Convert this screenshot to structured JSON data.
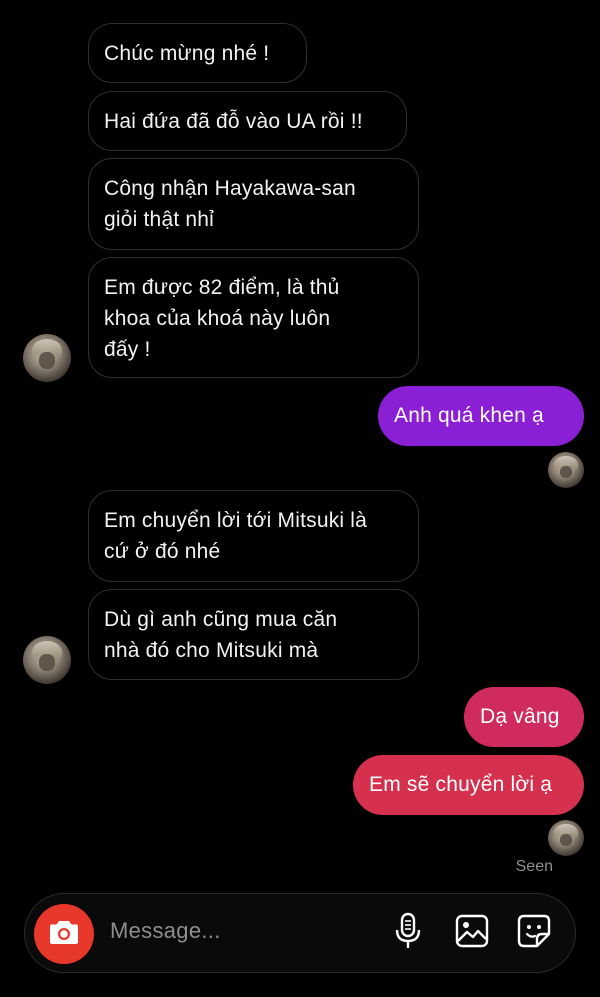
{
  "messages": [
    {
      "side": "in",
      "text": "Chúc mừng nhé !"
    },
    {
      "side": "in",
      "text": "Hai đứa đã đỗ vào UA rồi !!"
    },
    {
      "side": "in",
      "text": "Công nhận Hayakawa-san\ngiỏi thật nhỉ"
    },
    {
      "side": "in",
      "text": "Em được 82 điểm, là thủ\nkhoa của khoá này luôn\nđấy !"
    },
    {
      "side": "out",
      "text": "Anh quá khen ạ",
      "color": "#8a1fd6"
    },
    {
      "side": "in",
      "text": "Em chuyển lời tới Mitsuki là\ncứ ở đó nhé"
    },
    {
      "side": "in",
      "text": "Dù gì anh cũng mua căn\nnhà đó cho Mitsuki mà"
    },
    {
      "side": "out",
      "text": "Dạ vâng",
      "color": "#d02b5e"
    },
    {
      "side": "out",
      "text": "Em sẽ chuyển lời ạ",
      "color": "#d5304d"
    }
  ],
  "status": {
    "seen": "Seen"
  },
  "composer": {
    "placeholder": "Message...",
    "icons": [
      "camera-icon",
      "microphone-icon",
      "gallery-icon",
      "sticker-icon"
    ]
  }
}
